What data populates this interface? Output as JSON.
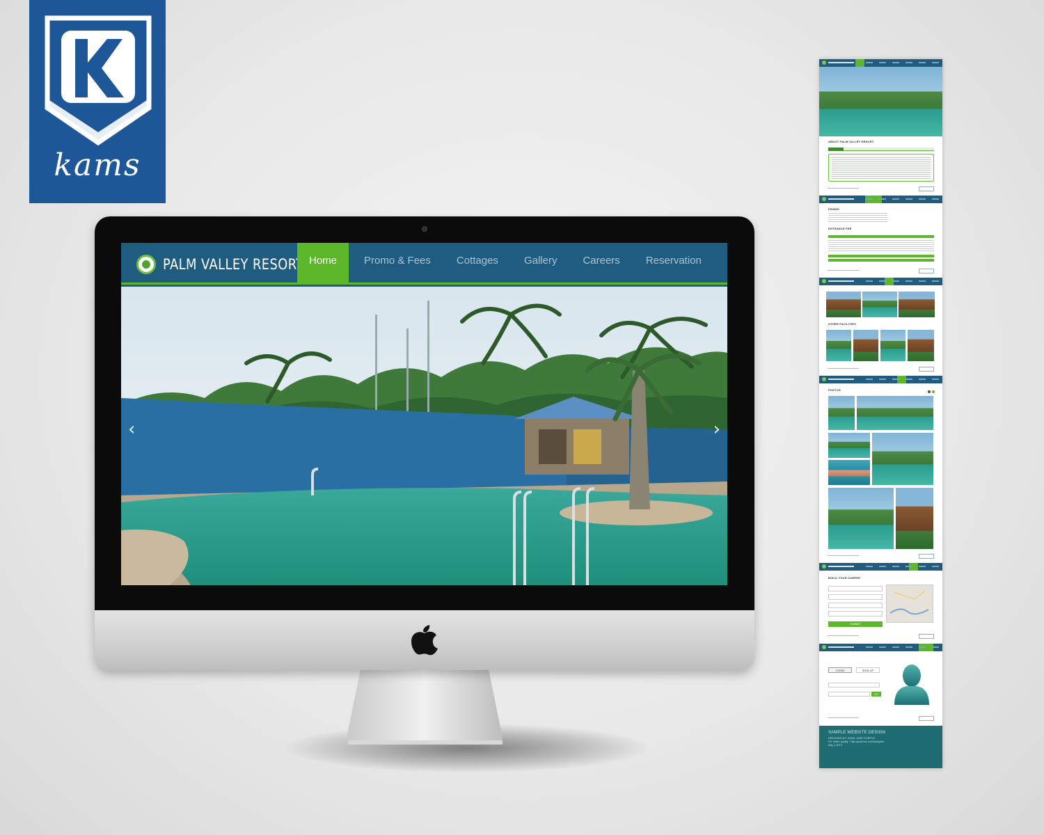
{
  "logo": {
    "word": "kams"
  },
  "website": {
    "brand": "PALM VALLEY RESORT",
    "nav": [
      "Home",
      "Promo & Fees",
      "Cottages",
      "Gallery",
      "Careers",
      "Reservation"
    ],
    "active_nav": "Home",
    "slider": {
      "prev": "‹",
      "next": "›"
    }
  },
  "thumbs": {
    "home_section": "ABOUT PALM VALLEY RESORT",
    "promo_section": "PROMO",
    "entrance_section": "ENTRANCE FEE",
    "cottages_section": "OTHER FACILITIES",
    "gallery_section": "PHOTOS",
    "careers_section": "BUILD YOUR CAREER",
    "careers_submit": "SUBMIT",
    "login_tab": "LOGIN",
    "signup_tab": "SIGN UP",
    "login_go": "GO",
    "footer": {
      "title": "SAMPLE WEBSITE DESIGN",
      "line1": "DESIGNED BY: KAMIL JADE CORPUZ",
      "line2": "For better quality : http://pinterest.com/kamjade/",
      "line3": "May 2,2013"
    }
  },
  "colors": {
    "header": "#1f5c7f",
    "accent_green": "#5cb82a",
    "logo_blue": "#1d5798",
    "footer_teal": "#1f6d73"
  },
  "icons": [
    "k-shield-icon",
    "apple-icon",
    "resort-logo-icon",
    "chevron-left-icon",
    "chevron-right-icon",
    "user-avatar-icon"
  ]
}
